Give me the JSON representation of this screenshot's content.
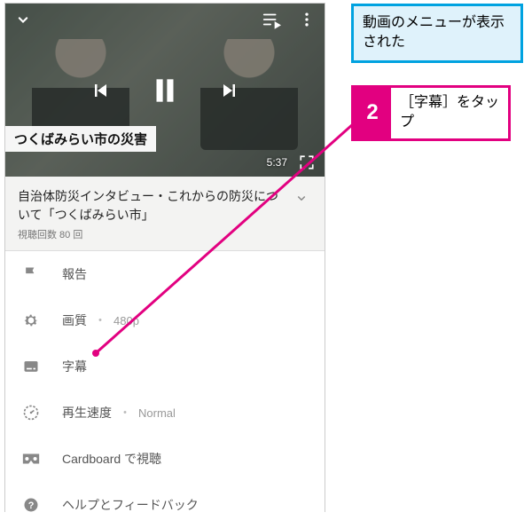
{
  "video": {
    "chapter_banner": "つくばみらい市の災害",
    "timestamp": "5:37"
  },
  "meta": {
    "title": "自治体防災インタビュー・これからの防災について「つくばみらい市」",
    "views": "視聴回数 80 回"
  },
  "menu": {
    "report": "報告",
    "quality_label": "画質",
    "quality_value": "480p",
    "captions": "字幕",
    "speed_label": "再生速度",
    "speed_value": "Normal",
    "cardboard": "Cardboard で視聴",
    "help": "ヘルプとフィードバック"
  },
  "callouts": {
    "blue": "動画のメニューが表示された",
    "step_number": "2",
    "step_text": "［字幕］をタップ"
  },
  "colors": {
    "accent": "#e20080",
    "blue": "#00a2e0"
  }
}
